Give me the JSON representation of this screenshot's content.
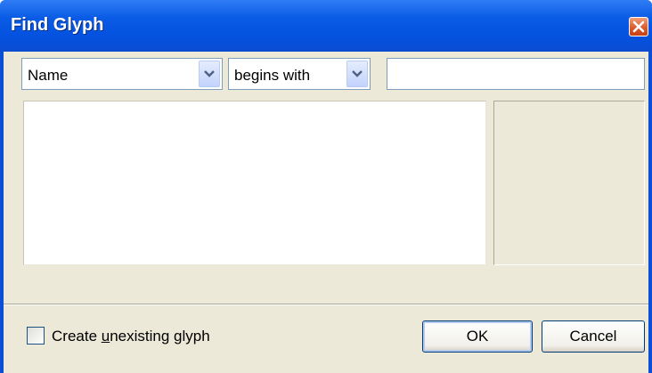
{
  "window": {
    "title": "Find Glyph"
  },
  "search": {
    "field_option": "Name",
    "match_option": "begins with",
    "query": ""
  },
  "options": {
    "create_label_prefix": "Create ",
    "create_label_mnemonic": "u",
    "create_label_rest": "nexisting glyph",
    "create_checked": false
  },
  "buttons": {
    "ok": "OK",
    "cancel": "Cancel"
  },
  "icons": {
    "close": "close-icon",
    "dropdown": "chevron-down-icon"
  },
  "colors": {
    "titlebar": "#0452df",
    "client": "#ece9d8",
    "close": "#de5b2c"
  }
}
